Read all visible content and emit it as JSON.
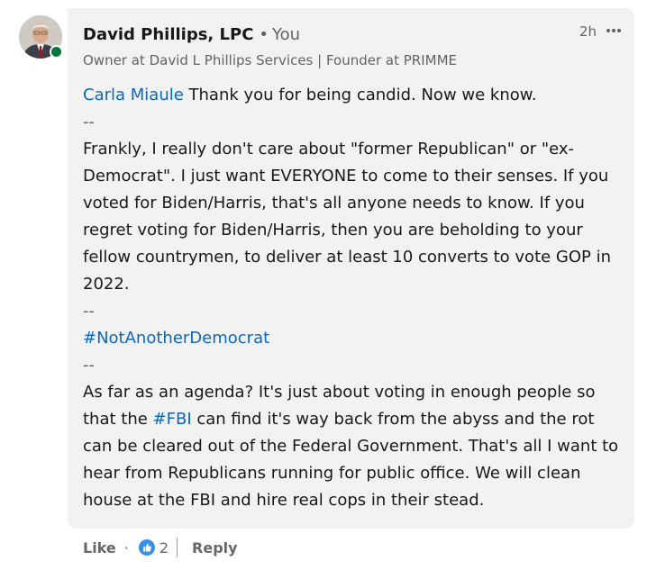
{
  "comment": {
    "author_name": "David Phillips, LPC",
    "separator": "•",
    "relation": "You",
    "headline": "Owner at David L Phillips Services | Founder at PRIMME",
    "time": "2h",
    "body": {
      "mention": "Carla Miaule",
      "line1_rest": " Thank you for being candid. Now we know.",
      "sep1": "--",
      "para1": "Frankly, I really don't care about \"former Republican\" or \"ex-Democrat\". I just want EVERYONE to come to their senses. If you voted for Biden/Harris, that's all anyone needs to know. If you regret voting for Biden/Harris, then you are beholding to your fellow countrymen, to deliver at least 10 converts to vote GOP in 2022.",
      "sep2": "--",
      "hashtag1": "#NotAnotherDemocrat",
      "sep3": "--",
      "para2_part1": "As far as an agenda? It's just about voting in enough people so that the ",
      "hashtag2": "#FBI",
      "para2_part2": " can find it's way back from the abyss and the rot can be cleared out of the Federal Government. That's all I want to hear from Republicans running for public office. We will clean house at the FBI and hire real cops in their stead."
    }
  },
  "actions": {
    "like_label": "Like",
    "dot": "·",
    "reaction_count": "2",
    "reply_label": "Reply"
  },
  "icons": {
    "more": "more-options-icon",
    "reaction": "like-reaction-icon",
    "presence": "online-status-icon"
  },
  "colors": {
    "bubble": "#f2f2f2",
    "link": "#0a66c2",
    "presence": "#057642"
  }
}
